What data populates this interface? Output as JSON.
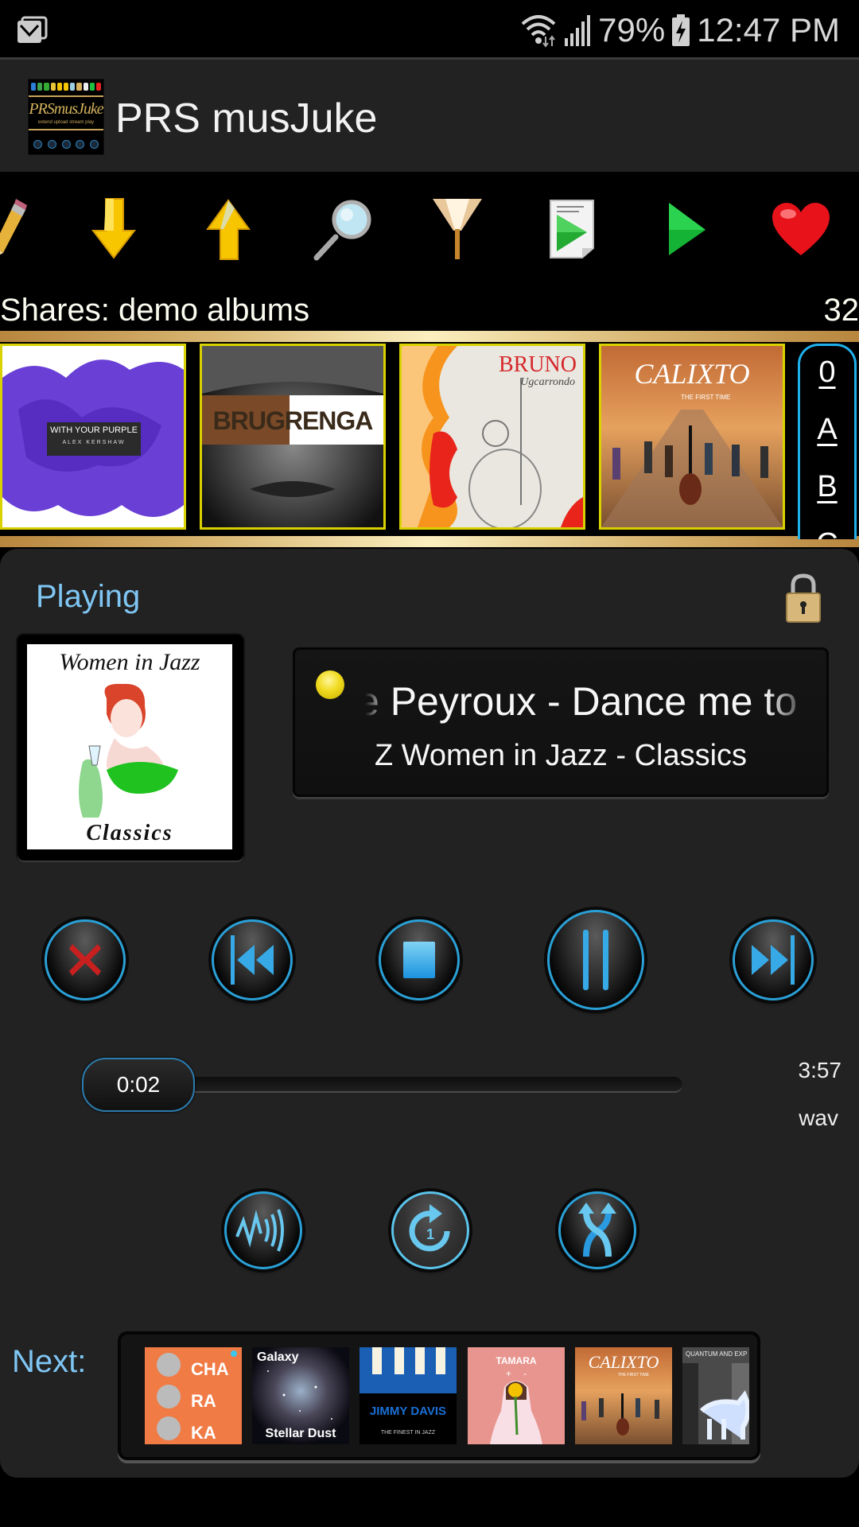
{
  "status_bar": {
    "notification_icon": "mail-icon",
    "battery": "79%",
    "time": "12:47 PM",
    "icons": [
      "wifi-icon",
      "signal-icon",
      "battery-charging-icon"
    ]
  },
  "app_bar": {
    "title": "PRS musJuke",
    "logo": {
      "name": "PRSmusJuke",
      "tagline": "extend upload stream play"
    }
  },
  "toolbar": {
    "tools": [
      {
        "name": "edit",
        "icon": "pencil-icon"
      },
      {
        "name": "move-down",
        "icon": "arrow-down-icon"
      },
      {
        "name": "move-up",
        "icon": "arrow-up-icon"
      },
      {
        "name": "search",
        "icon": "magnifier-icon"
      },
      {
        "name": "filter",
        "icon": "funnel-icon"
      },
      {
        "name": "play-list",
        "icon": "playlist-document-icon"
      },
      {
        "name": "play",
        "icon": "play-icon"
      },
      {
        "name": "favorites",
        "icon": "heart-icon"
      }
    ]
  },
  "shares": {
    "label": "Shares: demo albums",
    "count": "32"
  },
  "albums": [
    {
      "title": "WITH YOUR PURPLE",
      "artist": "ALEX KERSHAW"
    },
    {
      "title": "BRUGRENGA",
      "artist": ""
    },
    {
      "title": "BRUNO",
      "artist": "Ugcarrondo"
    },
    {
      "title": "CALIXTO",
      "artist": "THE FIRST TIME"
    }
  ],
  "index_bar": {
    "letters": [
      "0",
      "A",
      "B",
      "C"
    ]
  },
  "player": {
    "playing_label": "Playing",
    "cover": {
      "top_text": "Women in Jazz",
      "bottom_text": "Classics"
    },
    "track_title": "e Peyroux - Dance me to",
    "album_line": "Z Women in Jazz - Classics",
    "controls": {
      "remove": "remove-icon",
      "previous": "previous-icon",
      "stop": "stop-icon",
      "pause": "pause-icon",
      "next": "next-icon"
    },
    "position": "0:02",
    "duration": "3:57",
    "progress_fraction": 0.008,
    "format": "wav",
    "modes": {
      "equalizer": "sound-wave-icon",
      "repeat_one": "repeat-one-icon",
      "shuffle": "shuffle-icon"
    },
    "repeat_badge": "1"
  },
  "queue": {
    "label": "Next:",
    "items": [
      {
        "title": "CHA RA KA"
      },
      {
        "title": "Galaxy",
        "subtitle": "Stellar Dust"
      },
      {
        "title": "JIMMY DAVIS",
        "subtitle": "THE FINEST IN JAZZ"
      },
      {
        "title": "TAMARA",
        "subtitle": "+ -"
      },
      {
        "title": "CALIXTO",
        "subtitle": "THE FIRST TIME"
      },
      {
        "title": "QUANTUM AND EXP"
      }
    ]
  }
}
